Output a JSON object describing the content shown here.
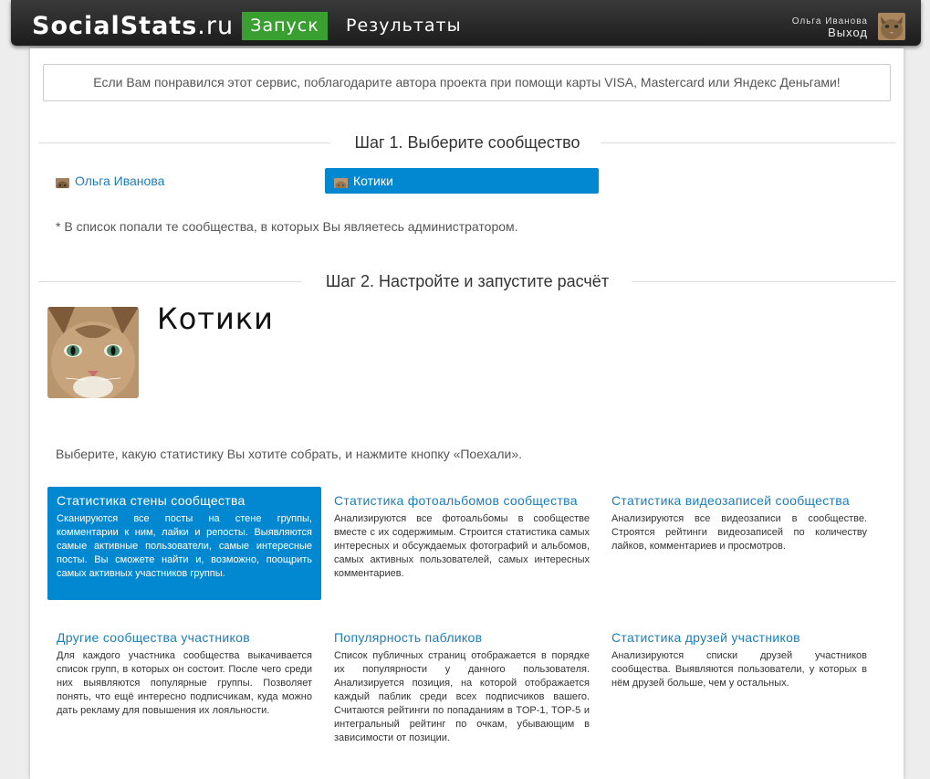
{
  "header": {
    "brand": "SocialStats",
    "brand_suffix": ".ru",
    "nav": {
      "launch": "Запуск",
      "results": "Результаты"
    },
    "user": {
      "name": "Ольга Иванова",
      "logout": "Выход"
    }
  },
  "donate_text": "Если Вам понравился этот сервис, поблагодарите автора проекта при помощи карты VISA, Mastercard или Яндекс Деньгами!",
  "step1": {
    "title": "Шаг 1. Выберите сообщество",
    "communities": [
      {
        "label": "Ольга Иванова",
        "selected": false
      },
      {
        "label": "Котики",
        "selected": true
      }
    ],
    "note": "* В список попали те сообщества, в которых Вы являетесь администратором."
  },
  "step2": {
    "title": "Шаг 2. Настройте и запустите расчёт",
    "group_name": "Котики",
    "instructions": "Выберите, какую статистику Вы хотите собрать, и нажмите кнопку «Поехали».",
    "cards": [
      {
        "title": "Статистика стены сообщества",
        "desc": "Сканируются все посты на стене группы, комментарии к ним, лайки и репосты. Выявляются самые активные пользователи, самые интересные посты. Вы сможете найти и, возможно, поощрить самых активных участников группы.",
        "selected": true
      },
      {
        "title": "Статистика фотоальбомов сообщества",
        "desc": "Анализируются все фотоальбомы в сообществе вместе с их содержимым. Строится статистика самых интересных и обсуждаемых фотографий и альбомов, самых активных пользователей, самых интересных комментариев.",
        "selected": false
      },
      {
        "title": "Статистика видеозаписей сообщества",
        "desc": "Анализируются все видеозаписи в сообществе. Строятся рейтинги видеозаписей по количеству лайков, комментариев и просмотров.",
        "selected": false
      },
      {
        "title": "Другие сообщества участников",
        "desc": "Для каждого участника сообщества выкачивается список групп, в которых он состоит. После чего среди них выявляются популярные группы. Позволяет понять, что ещё интересно подписчикам, куда можно дать рекламу для повышения их лояльности.",
        "selected": false
      },
      {
        "title": "Популярность пабликов",
        "desc": "Список публичных страниц отображается в порядке их популярности у данного пользователя. Анализируется позиция, на которой отображается каждый паблик среди всех подписчиков вашего. Считаются рейтинги по попаданиям в TOP-1, TOP-5 и интегральный рейтинг по очкам, убывающим в зависимости от позиции.",
        "selected": false
      },
      {
        "title": "Статистика друзей участников",
        "desc": "Анализируются списки друзей участников сообщества. Выявляются пользователи, у которых в нём друзей больше, чем у остальных.",
        "selected": false
      }
    ]
  },
  "colors": {
    "accent_blue": "#0288d1",
    "link_blue": "#1a7dbb",
    "launch_green": "#3a9f31",
    "header_dark": "#262626"
  }
}
